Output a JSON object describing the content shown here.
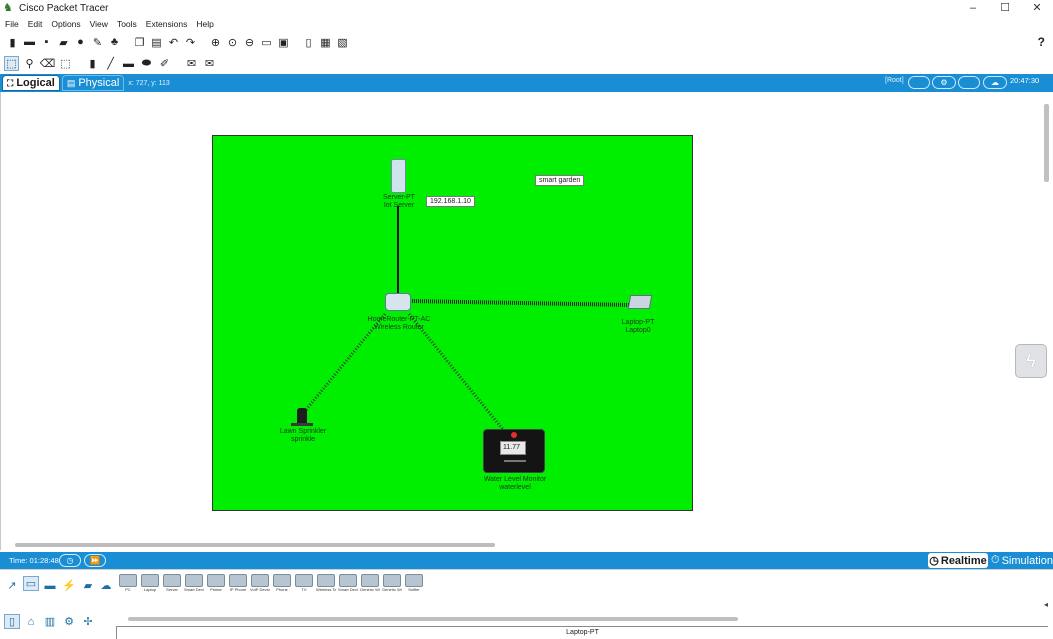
{
  "window": {
    "title": "Cisco Packet Tracer",
    "controls": [
      "–",
      "☐",
      "✕"
    ]
  },
  "menu": [
    "File",
    "Edit",
    "Options",
    "View",
    "Tools",
    "Extensions",
    "Help"
  ],
  "help_label": "?",
  "tabs": {
    "logical": "Logical",
    "physical": "Physical"
  },
  "cursor_coords": "x: 727, y: 113",
  "root_label": "[Root]",
  "clock": "20:47:30",
  "canvas": {
    "note_ip": "192.168.1.10",
    "note_title": "smart garden",
    "devices": [
      {
        "id": "server",
        "type": "Server-PT",
        "name": "Iot Server"
      },
      {
        "id": "router",
        "type": "HomeRouter-PT-AC",
        "name": "Wireless Router"
      },
      {
        "id": "laptop",
        "type": "Laptop-PT",
        "name": "Laptop0"
      },
      {
        "id": "sprinkler",
        "type": "Lawn Sprinkler",
        "name": "sprinkle"
      },
      {
        "id": "water",
        "type": "Water Level Monitor",
        "name": "waterlevel",
        "reading": "11.77"
      }
    ]
  },
  "status": {
    "time": "Time: 01:28:48",
    "realtime": "Realtime",
    "simulation": "Simulation"
  },
  "device_palette": [
    "PC",
    "Laptop",
    "Server",
    "Smart Device",
    "Printer",
    "IP Phone",
    "VoIP Device",
    "Phone",
    "TV",
    "Wireless Tablet",
    "Smart Device",
    "Generic Wireless",
    "Generic Wired",
    "Sniffer"
  ],
  "selected_device": "Laptop-PT",
  "colors": {
    "accent_blue": "#1a8ed4",
    "canvas_green": "#00ee00"
  }
}
